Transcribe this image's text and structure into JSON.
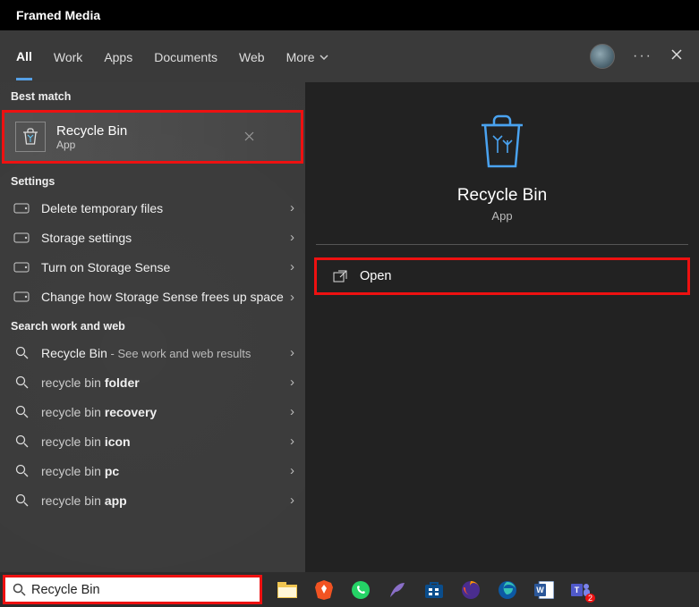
{
  "window": {
    "title": "Framed Media"
  },
  "tabs": {
    "all": "All",
    "work": "Work",
    "apps": "Apps",
    "documents": "Documents",
    "web": "Web",
    "more": "More"
  },
  "left": {
    "best_match_label": "Best match",
    "best_match": {
      "title": "Recycle Bin",
      "sub": "App"
    },
    "settings_label": "Settings",
    "settings_items": [
      "Delete temporary files",
      "Storage settings",
      "Turn on Storage Sense",
      "Change how Storage Sense frees up space"
    ],
    "search_section_label": "Search work and web",
    "primary_suggestion": {
      "term": "Recycle Bin",
      "suffix": " - See work and web results"
    },
    "suggestions": [
      {
        "prefix": "recycle bin ",
        "bold": "folder"
      },
      {
        "prefix": "recycle bin ",
        "bold": "recovery"
      },
      {
        "prefix": "recycle bin ",
        "bold": "icon"
      },
      {
        "prefix": "recycle bin ",
        "bold": "pc"
      },
      {
        "prefix": "recycle bin ",
        "bold": "app"
      }
    ]
  },
  "right": {
    "title": "Recycle Bin",
    "sub": "App",
    "open": "Open"
  },
  "search": {
    "value": "Recycle Bin"
  },
  "taskbar": {
    "teams_badge": "2"
  }
}
